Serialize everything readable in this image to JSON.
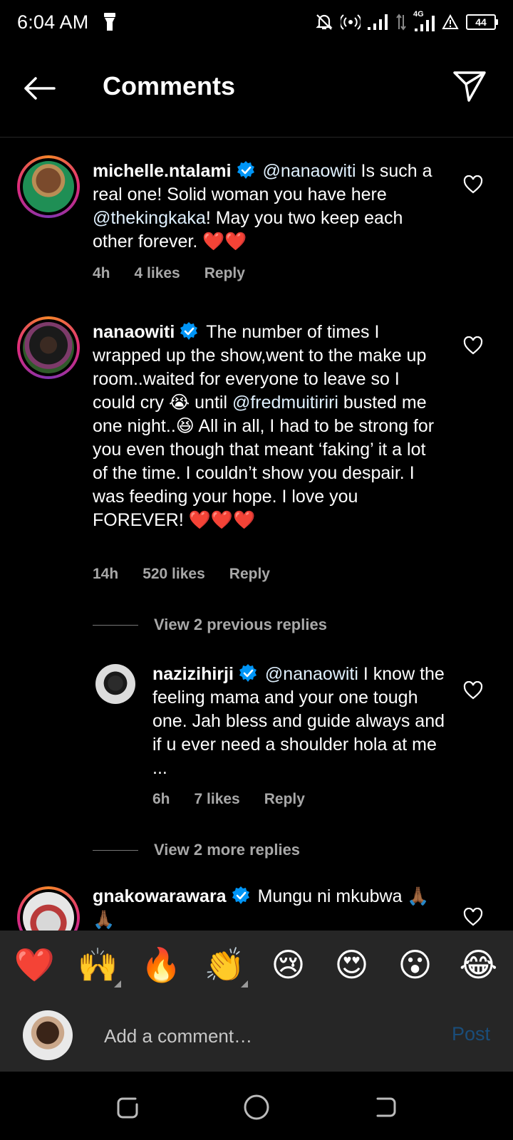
{
  "status_bar": {
    "time": "6:04 AM",
    "network": "4G",
    "battery": "44",
    "icons": [
      "torch-icon",
      "mute-icon",
      "hotspot-icon",
      "signal-icon",
      "data-arrows-icon",
      "signal-4g-icon",
      "warning-icon",
      "battery-icon"
    ]
  },
  "header": {
    "title": "Comments",
    "back_icon": "back-arrow-icon",
    "share_icon": "paper-plane-icon"
  },
  "comments": [
    {
      "username": "michelle.ntalami",
      "verified": true,
      "mention": "@nanaowiti",
      "text": " Is such a real one! Solid woman you have here ",
      "mention2": "@thekingkaka",
      "text2": "! May you two keep each other forever. ❤️❤️",
      "time": "4h",
      "likes": "4 likes",
      "reply": "Reply"
    },
    {
      "username": "nanaowiti",
      "verified": true,
      "text": "The number of times I wrapped up the show,went to the make up room..waited for everyone to leave so I could cry 😭 until ",
      "mention": "@fredmuitiriri",
      "text2": " busted me one night..😆 All in all, I had to be strong for you even though that meant ‘faking’ it a lot of the time. I couldn’t show you despair. I was feeding your hope. I love you FOREVER! ❤️❤️❤️",
      "time": "14h",
      "likes": "520 likes",
      "reply": "Reply",
      "view_previous": "View 2 previous replies",
      "replies": [
        {
          "username": "nazizihirji",
          "verified": true,
          "mention": "@nanaowiti",
          "text": " I know the feeling mama and your one tough one.  Jah bless and guide always and if u ever need a shoulder hola at me ...",
          "time": "6h",
          "likes": "7 likes",
          "reply": "Reply"
        }
      ],
      "view_more": "View 2 more replies"
    },
    {
      "username": "gnakowarawara",
      "verified": true,
      "text": "Mungu ni mkubwa 🙏🏾🙏🏾"
    }
  ],
  "emoji_bar": [
    "❤️",
    "🙌",
    "🔥",
    "👏",
    "😢",
    "😍",
    "😮",
    "😂"
  ],
  "compose": {
    "placeholder": "Add a comment…",
    "post_label": "Post"
  },
  "colors": {
    "background": "#000000",
    "panel": "#262626",
    "muted_text": "#a8a8a8",
    "verified_blue": "#0095f6",
    "post_disabled": "#1a4d7a"
  },
  "nav": [
    "recents-icon",
    "home-icon",
    "back-icon"
  ]
}
